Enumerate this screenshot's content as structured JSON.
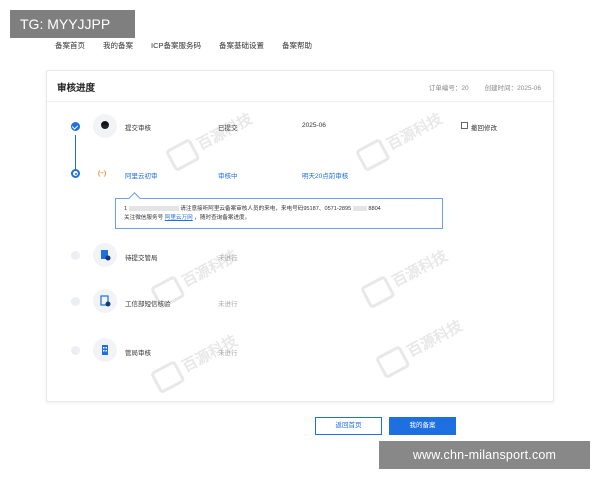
{
  "watermark_tag": "TG: MYYJJPP",
  "nav": [
    "备案首页",
    "我的备案",
    "ICP备案服务码",
    "备案基础设置",
    "备案帮助"
  ],
  "panel": {
    "title": "审核进度",
    "order_label": "订单编号：20",
    "created_label": "创建时间：2025-06"
  },
  "steps": [
    {
      "name": "提交审核",
      "status": "已提交",
      "time": "2025-06",
      "action": "撤回修改"
    },
    {
      "name": "阿里云初审",
      "status": "审核中",
      "time": "明天20点前审核"
    },
    {
      "name": "待提交管局",
      "status": "未进行"
    },
    {
      "name": "工信部短信核验",
      "status": "未进行"
    },
    {
      "name": "管局审核",
      "status": "未进行"
    }
  ],
  "callout": {
    "line1_a": "1",
    "line1_b": "请注意接听阿里云备案审核人员的来电，来电号码95187、0571-2895",
    "line1_c": "8804",
    "line2_a": "关注微信服务号",
    "line2_link": "阿里云万网",
    "line2_b": "，随时查询备案进度。"
  },
  "buttons": {
    "back": "返回首页",
    "mine": "我的备案"
  },
  "site_tag": "www.chn-milansport.com",
  "watermark_brand": "百源科技",
  "colors": {
    "accent": "#1e6fe0",
    "gray_tag": "#888888"
  }
}
